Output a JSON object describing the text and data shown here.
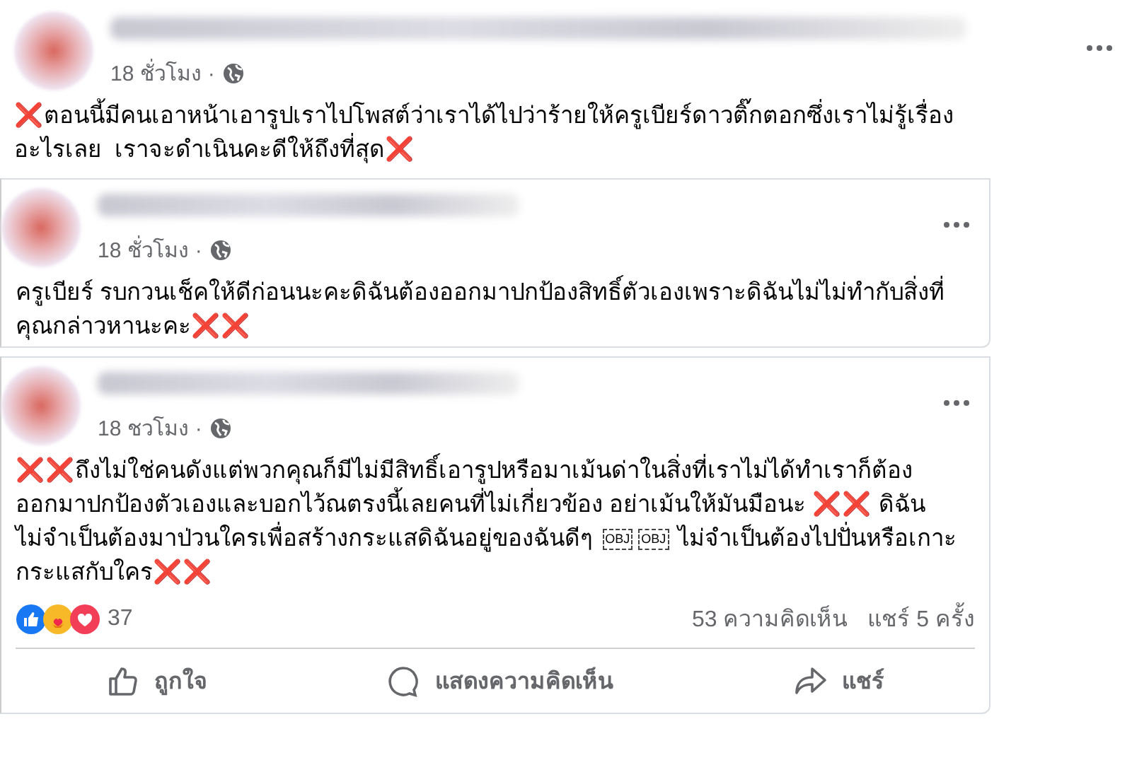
{
  "posts": [
    {
      "bordered": false,
      "time": "18 ชั่วโมง",
      "separator": "·",
      "segments": [
        {
          "kind": "text",
          "text": "❌ตอนนี้มีคนเอาหน้าเอารูปเราไปโพสต์ว่าเราได้ไปว่าร้ายให้ครูเบียร์ดาวติ๊กตอกซึ่งเราไม่รู้เรื่อง\nอะไรเลย  เราจะดำเนินคะดีให้ถึงที่สุด❌"
        }
      ]
    },
    {
      "bordered": true,
      "time": "18 ชั่วโมง",
      "separator": "·",
      "segments": [
        {
          "kind": "text",
          "text": "ครูเบียร์ รบกวนเช็คให้ดีก่อนนะคะดิฉันต้องออกมาปกป้องสิทธิ์ตัวเองเพราะดิฉันไม่ไม่ทำกับสิ่งที่\nคุณกล่าวหานะคะ❌❌"
        }
      ]
    },
    {
      "bordered": true,
      "time": "18 ชวโมง",
      "separator": "·",
      "segments": [
        {
          "kind": "text",
          "text": "❌❌ถึงไม่ใช่คนดังแต่พวกคุณก็มีไม่มีสิทธิ์เอารูปหรือมาเม้นด่าในสิ่งที่เราไม่ได้ทำเราก็ต้อง\nออกมาปกป้องตัวเองและบอกไว้ณตรงนี้เลยคนที่ไม่เกี่ยวข้อง อย่าเม้นให้มันมือนะ ❌❌ ดิฉัน\nไม่จำเป็นต้องมาป่วนใครเพื่อสร้างกระแสดิฉันอยู่ของฉันดีๆ "
        },
        {
          "kind": "object-box",
          "label": "OBJ"
        },
        {
          "kind": "object-box",
          "label": "OBJ"
        },
        {
          "kind": "text",
          "text": " ไม่จำเป็นต้องไปปั่นหรือเกาะ\nกระแสกับใคร❌❌"
        }
      ],
      "footer": {
        "reaction_count": "37",
        "comments": "53 ความคิดเห็น",
        "shares": "แชร์ 5 ครั้ง",
        "actions": [
          {
            "kind": "like",
            "label": "ถูกใจ"
          },
          {
            "kind": "comment",
            "label": "แสดงความคิดเห็น"
          },
          {
            "kind": "share",
            "label": "แชร์"
          }
        ]
      }
    }
  ]
}
